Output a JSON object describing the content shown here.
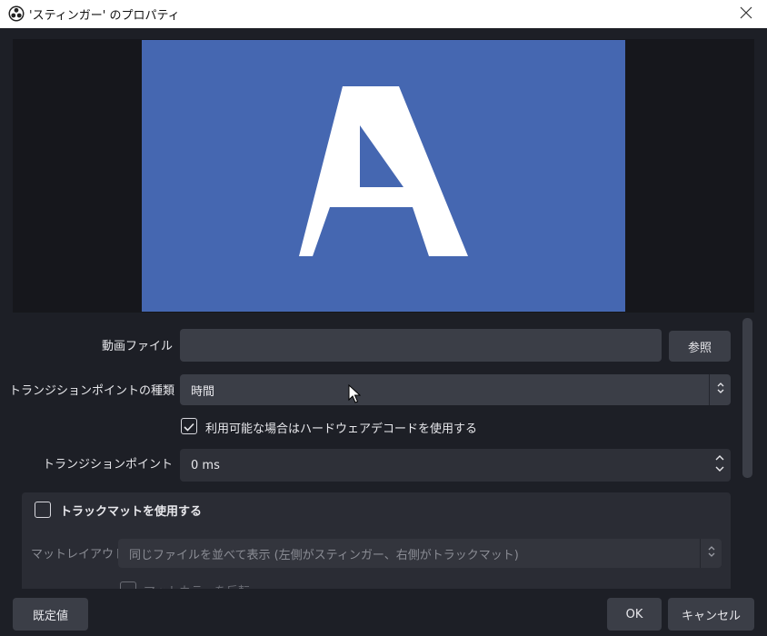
{
  "window": {
    "title": "'スティンガー' のプロパティ",
    "app_icon": "obs-icon",
    "close_icon": "close-icon"
  },
  "preview": {
    "letter": "A",
    "bg_color": "#4567b1"
  },
  "form": {
    "video_file": {
      "label": "動画ファイル",
      "value": "",
      "browse_label": "参照"
    },
    "transition_point_type": {
      "label": "トランジションポイントの種類",
      "value": "時間"
    },
    "hw_decode": {
      "label": "利用可能な場合はハードウェアデコードを使用する",
      "checked": true
    },
    "transition_point": {
      "label": "トランジションポイント",
      "value": "0 ms"
    },
    "track_matte": {
      "label": "トラックマットを使用する",
      "checked": false,
      "layout_label": "マットレイアウト",
      "layout_value": "同じファイルを並べて表示 (左側がスティンガー、右側がトラックマット)",
      "invert_label": "マットカラーを反転"
    }
  },
  "footer": {
    "defaults_label": "既定値",
    "ok_label": "OK",
    "cancel_label": "キャンセル"
  }
}
